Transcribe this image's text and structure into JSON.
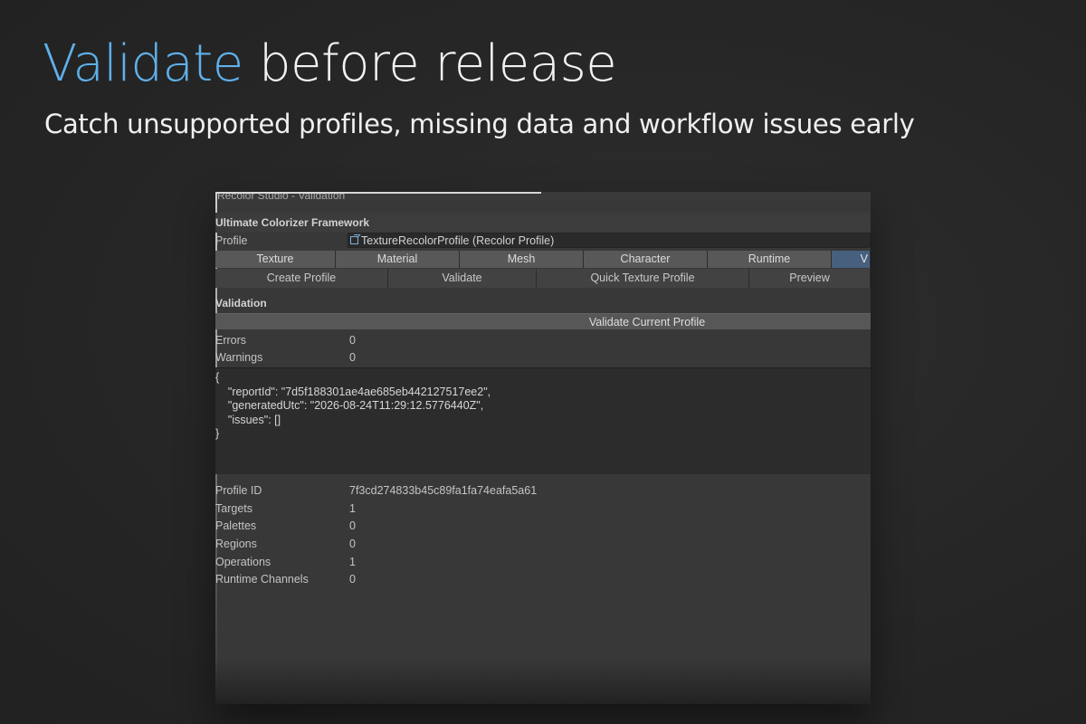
{
  "hero": {
    "title_accent": "Validate",
    "title_rest": " before release",
    "subtitle": "Catch unsupported profiles, missing data and workflow issues early"
  },
  "window": {
    "title": "Recolor Studio - Validation",
    "framework_header": "Ultimate Colorizer Framework",
    "profile_label": "Profile",
    "profile_value": "TextureRecolorProfile (Recolor Profile)",
    "profile_icon": "scriptable-object-icon",
    "tabs": [
      {
        "label": "Texture",
        "selected": false
      },
      {
        "label": "Material",
        "selected": false
      },
      {
        "label": "Mesh",
        "selected": false
      },
      {
        "label": "Character",
        "selected": false
      },
      {
        "label": "Runtime",
        "selected": false
      },
      {
        "label": "V",
        "selected": true
      }
    ],
    "toolbar": {
      "create_profile": "Create Profile",
      "validate": "Validate",
      "quick_texture_profile": "Quick Texture Profile",
      "preview": "Preview"
    },
    "validation": {
      "header": "Validation",
      "validate_button": "Validate Current Profile",
      "errors_label": "Errors",
      "errors_value": "0",
      "warnings_label": "Warnings",
      "warnings_value": "0",
      "report_lines": [
        "{",
        "    \"reportId\": \"7d5f188301ae4ae685eb442127517ee2\",",
        "    \"generatedUtc\": \"2026-08-24T11:29:12.5776440Z\",",
        "    \"issues\": []",
        "}"
      ]
    },
    "stats": [
      {
        "label": "Profile ID",
        "value": "7f3cd274833b45c89fa1fa74eafa5a61"
      },
      {
        "label": "Targets",
        "value": "1"
      },
      {
        "label": "Palettes",
        "value": "0"
      },
      {
        "label": "Regions",
        "value": "0"
      },
      {
        "label": "Operations",
        "value": "1"
      },
      {
        "label": "Runtime Channels",
        "value": "0"
      }
    ]
  },
  "colors": {
    "accent": "#5fb0ea",
    "selected_tab": "#46607e",
    "background": "#262626",
    "panel": "#383838"
  }
}
